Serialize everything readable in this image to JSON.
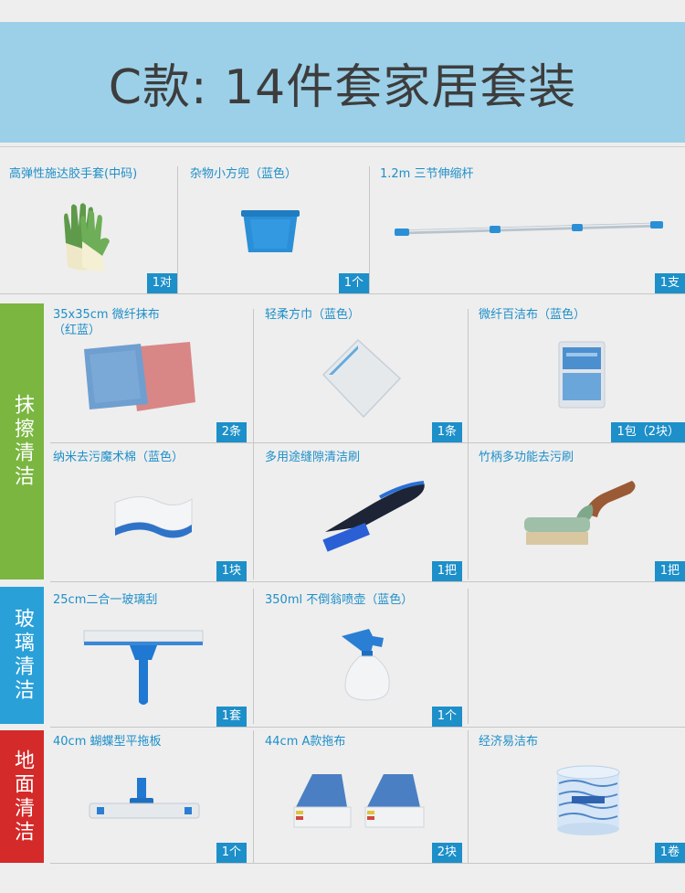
{
  "title": "C款: 14件套家居套装",
  "colors": {
    "accent": "#1d8fc9",
    "banner": "#9cd0e8",
    "green": "#7ab640",
    "blue": "#2aa0d8",
    "red": "#d42a2a"
  },
  "categories": [
    {
      "name": "抹擦清洁",
      "color": "#7ab640"
    },
    {
      "name": "玻璃清洁",
      "color": "#2aa0d8"
    },
    {
      "name": "地面清洁",
      "color": "#d42a2a"
    }
  ],
  "row1": [
    {
      "label": "高弹性施达胶手套(中码)",
      "qty": "1对",
      "icon": "gloves-icon"
    },
    {
      "label": "杂物小方兜（蓝色）",
      "qty": "1个",
      "icon": "basket-icon"
    },
    {
      "label": "1.2m 三节伸缩杆",
      "qty": "1支",
      "icon": "telescopic-pole-icon"
    }
  ],
  "wipe": [
    {
      "label": "35x35cm 微纤抹布",
      "label2": "（红蓝）",
      "qty": "2条",
      "icon": "microfiber-cloths-icon"
    },
    {
      "label": "轻柔方巾（蓝色）",
      "label2": "",
      "qty": "1条",
      "icon": "soft-towel-icon"
    },
    {
      "label": "微纤百洁布（蓝色）",
      "label2": "",
      "qty": "1包（2块）",
      "icon": "scouring-pad-pack-icon"
    },
    {
      "label": "纳米去污魔术棉（蓝色）",
      "label2": "",
      "qty": "1块",
      "icon": "magic-sponge-icon"
    },
    {
      "label": "多用途缝隙清洁刷",
      "label2": "",
      "qty": "1把",
      "icon": "crevice-brush-icon"
    },
    {
      "label": "竹柄多功能去污刷",
      "label2": "",
      "qty": "1把",
      "icon": "bamboo-brush-icon"
    }
  ],
  "glass": [
    {
      "label": "25cm二合一玻璃刮",
      "qty": "1套",
      "icon": "window-squeegee-icon"
    },
    {
      "label": "350ml 不倒翁喷壶（蓝色）",
      "qty": "1个",
      "icon": "spray-bottle-icon"
    }
  ],
  "floor": [
    {
      "label": "40cm 蝴蝶型平拖板",
      "qty": "1个",
      "icon": "flat-mop-icon"
    },
    {
      "label": "44cm A款拖布",
      "qty": "2块",
      "icon": "mop-pads-icon"
    },
    {
      "label": "经济易洁布",
      "qty": "1卷",
      "icon": "cloth-roll-icon"
    }
  ]
}
